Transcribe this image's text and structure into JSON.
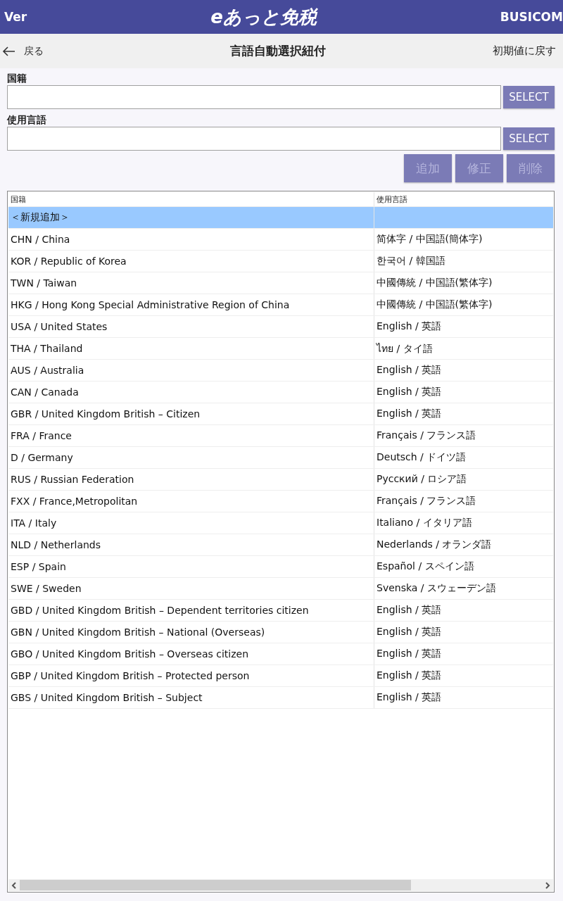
{
  "header": {
    "version": "Ver",
    "logo": "eあっと免税",
    "company": "BUSICOM"
  },
  "nav": {
    "back": "戻る",
    "title": "言語自動選択紐付",
    "reset": "初期値に戻す"
  },
  "fields": [
    {
      "label": "国籍",
      "button": "SELECT"
    },
    {
      "label": "使用言語",
      "button": "SELECT"
    }
  ],
  "actions": [
    {
      "label": "追加",
      "disabled": true
    },
    {
      "label": "修正",
      "disabled": true
    },
    {
      "label": "削除",
      "disabled": true
    }
  ],
  "table": {
    "columns": [
      "国籍",
      "使用言語"
    ],
    "rows": [
      {
        "cells": [
          "＜新規追加＞",
          ""
        ],
        "selected": true
      },
      {
        "cells": [
          "CHN / China",
          "简体字 / 中国語(簡体字)"
        ],
        "selected": false
      },
      {
        "cells": [
          "KOR / Republic of Korea",
          "한국어 / 韓国語"
        ],
        "selected": false
      },
      {
        "cells": [
          "TWN / Taiwan",
          "中國傳統 / 中国語(繁体字)"
        ],
        "selected": false
      },
      {
        "cells": [
          "HKG / Hong Kong Special Administrative Region of China",
          "中國傳統 / 中国語(繁体字)"
        ],
        "selected": false
      },
      {
        "cells": [
          "USA / United States",
          "English / 英語"
        ],
        "selected": false
      },
      {
        "cells": [
          "THA / Thailand",
          "ไทย / タイ語"
        ],
        "selected": false
      },
      {
        "cells": [
          "AUS / Australia",
          "English / 英語"
        ],
        "selected": false
      },
      {
        "cells": [
          "CAN / Canada",
          "English / 英語"
        ],
        "selected": false
      },
      {
        "cells": [
          "GBR / United Kingdom British – Citizen",
          "English / 英語"
        ],
        "selected": false
      },
      {
        "cells": [
          "FRA / France",
          "Français / フランス語"
        ],
        "selected": false
      },
      {
        "cells": [
          "D / Germany",
          "Deutsch / ドイツ語"
        ],
        "selected": false
      },
      {
        "cells": [
          "RUS / Russian Federation",
          "Русский / ロシア語"
        ],
        "selected": false
      },
      {
        "cells": [
          "FXX / France,Metropolitan",
          "Français / フランス語"
        ],
        "selected": false
      },
      {
        "cells": [
          "ITA / Italy",
          "Italiano / イタリア語"
        ],
        "selected": false
      },
      {
        "cells": [
          "NLD / Netherlands",
          "Nederlands / オランダ語"
        ],
        "selected": false
      },
      {
        "cells": [
          "ESP / Spain",
          "Español / スペイン語"
        ],
        "selected": false
      },
      {
        "cells": [
          "SWE / Sweden",
          "Svenska / スウェーデン語"
        ],
        "selected": false
      },
      {
        "cells": [
          "GBD / United Kingdom British – Dependent territories citizen",
          "English / 英語"
        ],
        "selected": false
      },
      {
        "cells": [
          "GBN / United Kingdom British – National (Overseas)",
          "English / 英語"
        ],
        "selected": false
      },
      {
        "cells": [
          "GBO / United Kingdom British – Overseas citizen",
          "English / 英語"
        ],
        "selected": false
      },
      {
        "cells": [
          "GBP / United Kingdom British – Protected person",
          "English / 英語"
        ],
        "selected": false
      },
      {
        "cells": [
          "GBS / United Kingdom British – Subject",
          "English / 英語"
        ],
        "selected": false
      }
    ]
  }
}
